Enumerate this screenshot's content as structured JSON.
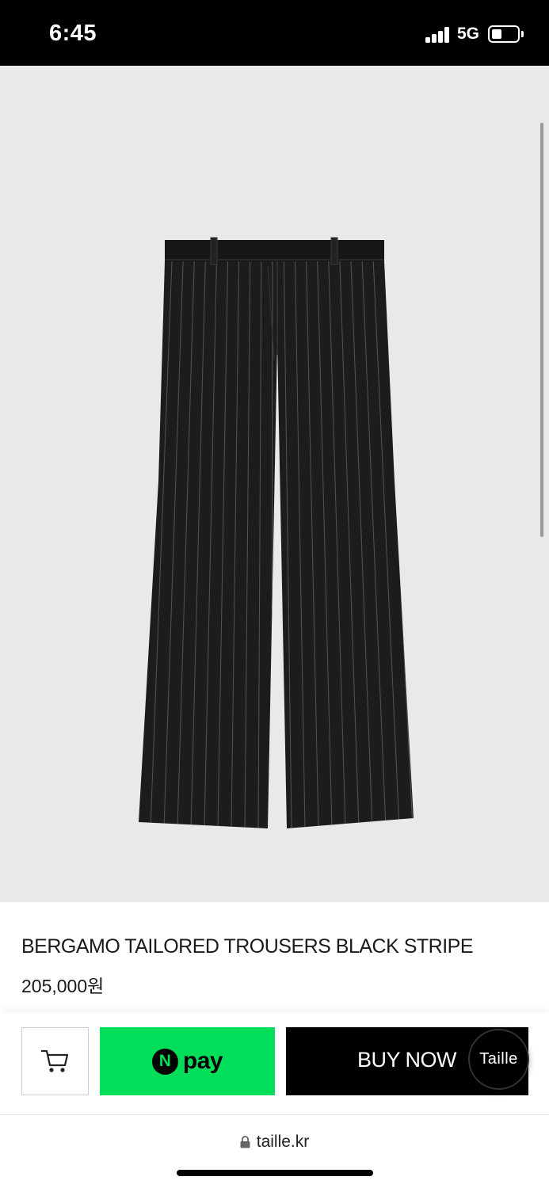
{
  "status_bar": {
    "time": "6:45",
    "network": "5G",
    "signal_bars": 4,
    "battery_level": 0.3
  },
  "product": {
    "name": "BERGAMO TAILORED TROUSERS BLACK STRIPE",
    "price": "205,000원",
    "image_icon": "black-pinstripe-trousers"
  },
  "actions": {
    "cart_icon": "cart-icon",
    "npay_n": "N",
    "npay_label": "pay",
    "buy_label": "BUY NOW",
    "taille_badge": "Taille"
  },
  "browser": {
    "url": "taille.kr",
    "lock_icon": "lock-icon"
  },
  "colors": {
    "npay_green": "#03de5a",
    "buy_black": "#000000",
    "image_bg": "#e9e9e9"
  }
}
